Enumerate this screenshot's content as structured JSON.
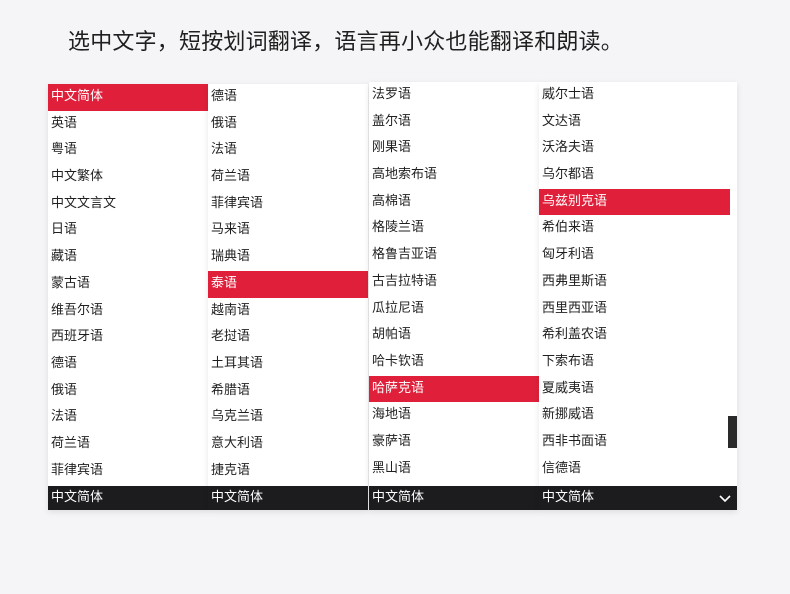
{
  "headline": "选中文字，短按划词翻译，语言再小众也能翻译和朗读。",
  "panels": [
    {
      "items": [
        "中文简体",
        "英语",
        "粤语",
        "中文繁体",
        "中文文言文",
        "日语",
        "藏语",
        "蒙古语",
        "维吾尔语",
        "西班牙语",
        "德语",
        "俄语",
        "法语",
        "荷兰语",
        "菲律宾语"
      ],
      "selected_index": 0,
      "footer": "中文简体"
    },
    {
      "items": [
        "德语",
        "俄语",
        "法语",
        "荷兰语",
        "菲律宾语",
        "马来语",
        "瑞典语",
        "泰语",
        "越南语",
        "老挝语",
        "土耳其语",
        "希腊语",
        "乌克兰语",
        "意大利语",
        "捷克语"
      ],
      "selected_index": 7,
      "footer": "中文简体"
    },
    {
      "items": [
        "法罗语",
        "盖尔语",
        "刚果语",
        "高地索布语",
        "高棉语",
        "格陵兰语",
        "格鲁吉亚语",
        "古吉拉特语",
        "瓜拉尼语",
        "胡帕语",
        "哈卡钦语",
        "哈萨克语",
        "海地语",
        "豪萨语",
        "黑山语"
      ],
      "selected_index": 11,
      "footer": "中文简体"
    },
    {
      "items": [
        "威尔士语",
        "文达语",
        "沃洛夫语",
        "乌尔都语",
        "乌兹别克语",
        "希伯来语",
        "匈牙利语",
        "西弗里斯语",
        "西里西亚语",
        "希利盖农语",
        "下索布语",
        "夏威夷语",
        "新挪威语",
        "西非书面语",
        "信德语"
      ],
      "selected_index": 4,
      "footer": "中文简体"
    }
  ],
  "colors": {
    "accent": "#e0203a",
    "footer_bg": "#1c1c1e"
  },
  "icons": {
    "footer_dropdown": "chevron-down-icon"
  }
}
